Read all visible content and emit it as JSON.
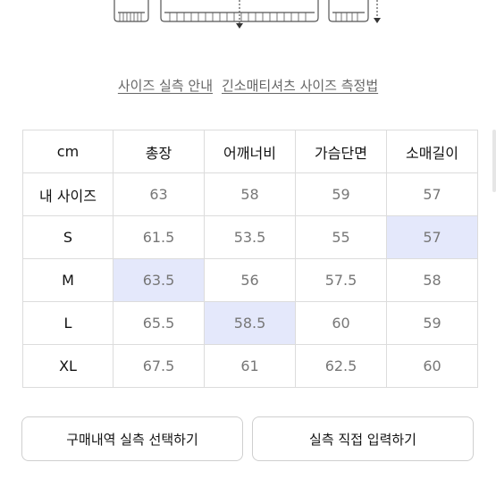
{
  "links": {
    "measure_guide": "사이즈 실측 안내",
    "long_sleeve_guide": "긴소매티셔츠 사이즈 측정법"
  },
  "table": {
    "headers": [
      "cm",
      "총장",
      "어깨너비",
      "가슴단면",
      "소매길이"
    ],
    "rows": [
      {
        "label": "내 사이즈",
        "values": [
          "63",
          "58",
          "59",
          "57"
        ]
      },
      {
        "label": "S",
        "values": [
          "61.5",
          "53.5",
          "55",
          "57"
        ]
      },
      {
        "label": "M",
        "values": [
          "63.5",
          "56",
          "57.5",
          "58"
        ]
      },
      {
        "label": "L",
        "values": [
          "65.5",
          "58.5",
          "60",
          "59"
        ]
      },
      {
        "label": "XL",
        "values": [
          "67.5",
          "61",
          "62.5",
          "60"
        ]
      }
    ],
    "highlight_color": "#e4e8fb"
  },
  "buttons": {
    "select_purchase": "구매내역 실측 선택하기",
    "direct_input": "실측 직접 입력하기"
  }
}
